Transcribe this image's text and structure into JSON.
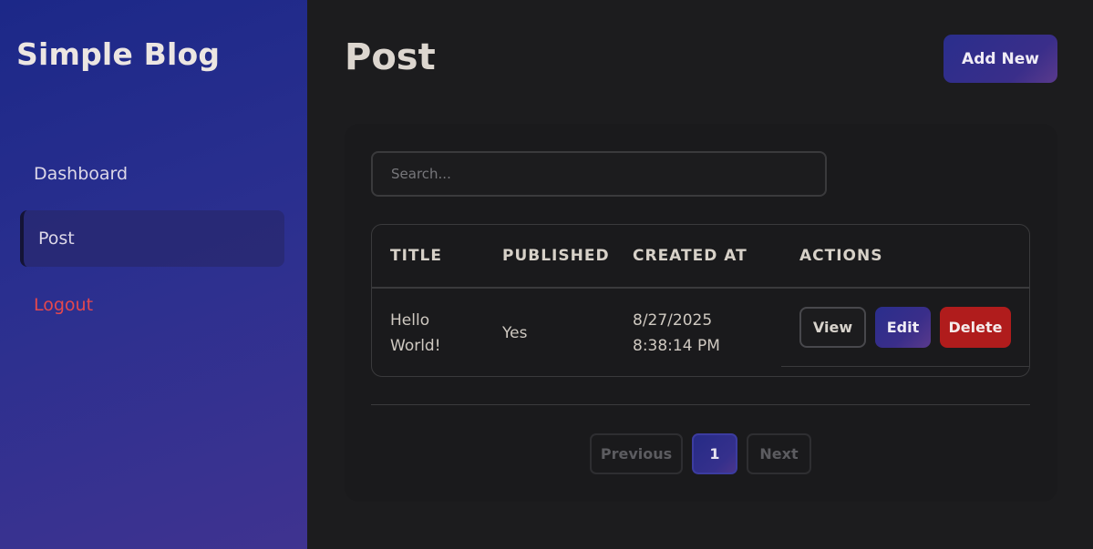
{
  "sidebar": {
    "brand": "Simple Blog",
    "items": [
      {
        "label": "Dashboard",
        "active": false
      },
      {
        "label": "Post",
        "active": true
      },
      {
        "label": "Logout",
        "active": false
      }
    ]
  },
  "header": {
    "title": "Post",
    "add_label": "Add New"
  },
  "search": {
    "placeholder": "Search..."
  },
  "table": {
    "columns": [
      "TITLE",
      "PUBLISHED",
      "CREATED AT",
      "ACTIONS"
    ],
    "rows": [
      {
        "title_line1": "Hello",
        "title_line2": "World!",
        "published": "Yes",
        "created_date": "8/27/2025",
        "created_time": "8:38:14 PM"
      }
    ],
    "actions": {
      "view": "View",
      "edit": "Edit",
      "delete": "Delete"
    }
  },
  "pagination": {
    "previous": "Previous",
    "current": "1",
    "next": "Next"
  },
  "colors": {
    "accent": "#2a2e8c",
    "danger": "#b01c1c",
    "logout": "#e5484d"
  }
}
